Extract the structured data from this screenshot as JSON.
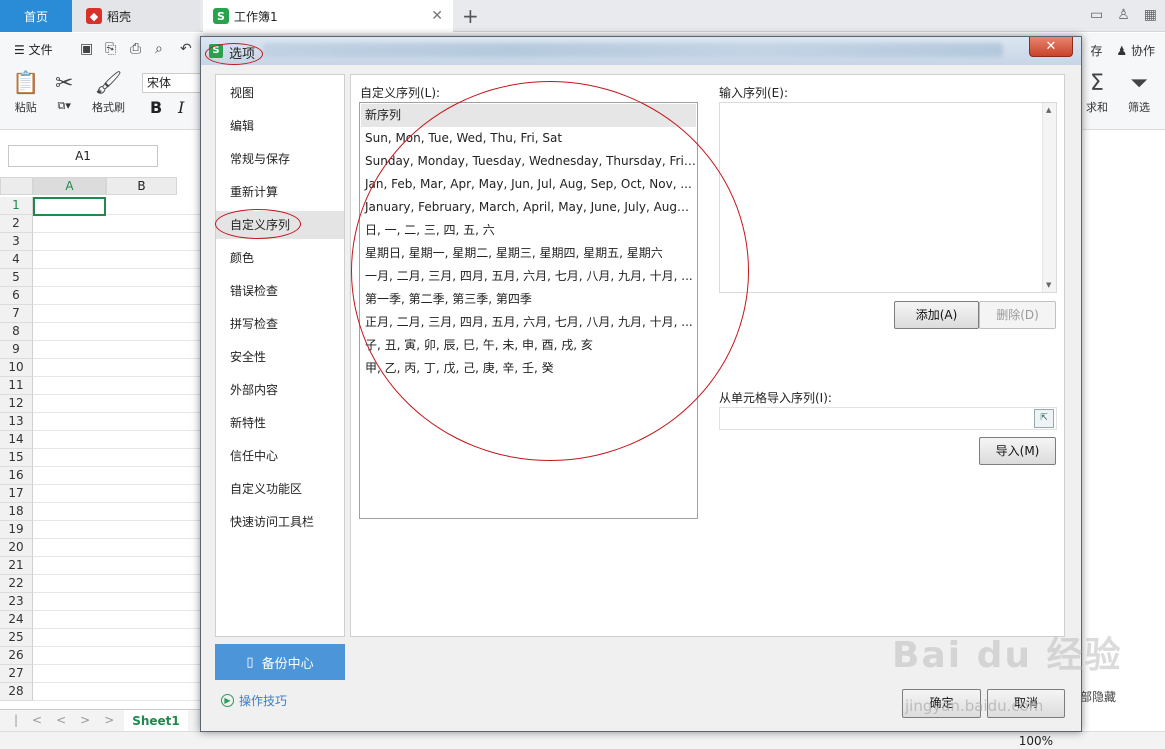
{
  "tabs": {
    "home": "首页",
    "daoke": "稻壳",
    "workbook": "工作簿1",
    "add": "+",
    "close": "✕"
  },
  "menu": {
    "file": "文件",
    "save_right": "存",
    "collab": "协作"
  },
  "ribbon": {
    "paste": "粘贴",
    "format_painter": "格式刷",
    "font_name": "宋体",
    "bold": "B",
    "italic": "I",
    "sum": "求和",
    "filter": "筛选"
  },
  "sheet": {
    "name_box": "A1",
    "columns": [
      "A",
      "B"
    ],
    "rows": [
      "1",
      "2",
      "3",
      "4",
      "5",
      "6",
      "7",
      "8",
      "9",
      "10",
      "11",
      "12",
      "13",
      "14",
      "15",
      "16",
      "17",
      "18",
      "19",
      "20",
      "21",
      "22",
      "23",
      "24",
      "25",
      "26",
      "27",
      "28"
    ],
    "sheet_tab": "Sheet1",
    "zoom": "100%",
    "hide_label": "部隐藏"
  },
  "dialog": {
    "title": "选项",
    "close": "✕",
    "nav": [
      "视图",
      "编辑",
      "常规与保存",
      "重新计算",
      "自定义序列",
      "颜色",
      "错误检查",
      "拼写检查",
      "安全性",
      "外部内容",
      "新特性",
      "信任中心",
      "自定义功能区",
      "快速访问工具栏"
    ],
    "active_nav": "自定义序列",
    "backup": "备份中心",
    "tips": "操作技巧",
    "list_label": "自定义序列(L):",
    "sequences": [
      "新序列",
      "Sun, Mon, Tue, Wed, Thu, Fri, Sat",
      "Sunday, Monday, Tuesday, Wednesday, Thursday, Frid...",
      "Jan, Feb, Mar, Apr, May, Jun, Jul, Aug, Sep, Oct, Nov, ...",
      "January, February, March, April, May, June, July, Augus...",
      "日, 一, 二, 三, 四, 五, 六",
      "星期日, 星期一, 星期二, 星期三, 星期四, 星期五, 星期六",
      "一月, 二月, 三月, 四月, 五月, 六月, 七月, 八月, 九月, 十月, ...",
      "第一季, 第二季, 第三季, 第四季",
      "正月, 二月, 三月, 四月, 五月, 六月, 七月, 八月, 九月, 十月, ...",
      "子, 丑, 寅, 卯, 辰, 巳, 午, 未, 申, 酉, 戌, 亥",
      "甲, 乙, 丙, 丁, 戊, 己, 庚, 辛, 壬, 癸"
    ],
    "input_label": "输入序列(E):",
    "add_btn": "添加(A)",
    "delete_btn": "删除(D)",
    "import_label": "从单元格导入序列(I):",
    "import_btn": "导入(M)",
    "ok": "确定",
    "cancel": "取消"
  },
  "watermark": {
    "main": "Bai du 经验",
    "sub": "jingyan.baidu.com"
  }
}
